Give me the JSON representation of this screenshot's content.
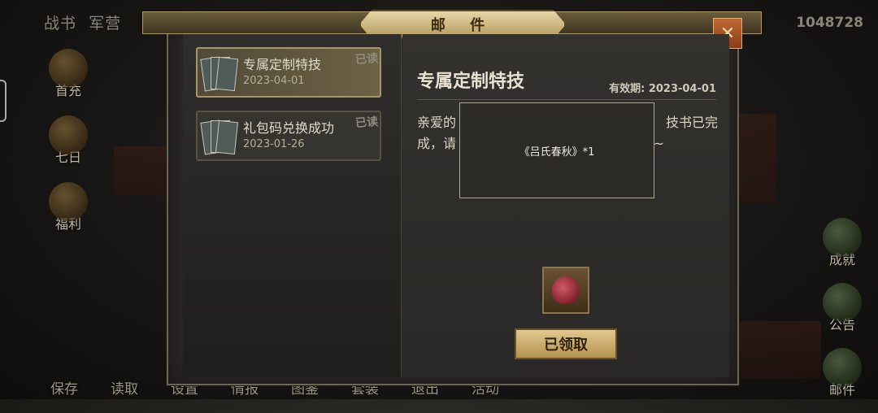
{
  "topbar": {
    "tabs": [
      "战书",
      "军营"
    ],
    "currency": "1048728"
  },
  "left_menu": [
    {
      "label": "首充",
      "icon": "first-charge-icon"
    },
    {
      "label": "七日",
      "icon": "seven-day-icon"
    },
    {
      "label": "福利",
      "icon": "welfare-icon"
    }
  ],
  "right_menu": [
    {
      "label": "成就",
      "icon": "achievement-icon"
    },
    {
      "label": "公告",
      "icon": "announcement-icon"
    },
    {
      "label": "邮件",
      "icon": "mail-icon"
    }
  ],
  "bottom_bar": [
    "保存",
    "读取",
    "设置",
    "情报",
    "图鉴",
    "套装",
    "退出",
    "活动"
  ],
  "mail_window": {
    "title": "邮 件",
    "close_icon": "close-icon",
    "items": [
      {
        "subject": "专属定制特技",
        "date": "2023-04-01",
        "status": "已读",
        "active": true
      },
      {
        "subject": "礼包码兑换成功",
        "date": "2023-01-26",
        "status": "已读",
        "active": false
      }
    ],
    "detail": {
      "title": "专属定制特技",
      "validity": "有效期: 2023-04-01",
      "body_line1_start": "亲爱的",
      "body_line1_end": "技书已完",
      "body_line2_start": "成，请",
      "body_line2_end": "乐~",
      "tooltip": "《吕氏春秋》*1",
      "reward_icon": "red-pouch-icon",
      "claim_label": "已领取"
    }
  }
}
